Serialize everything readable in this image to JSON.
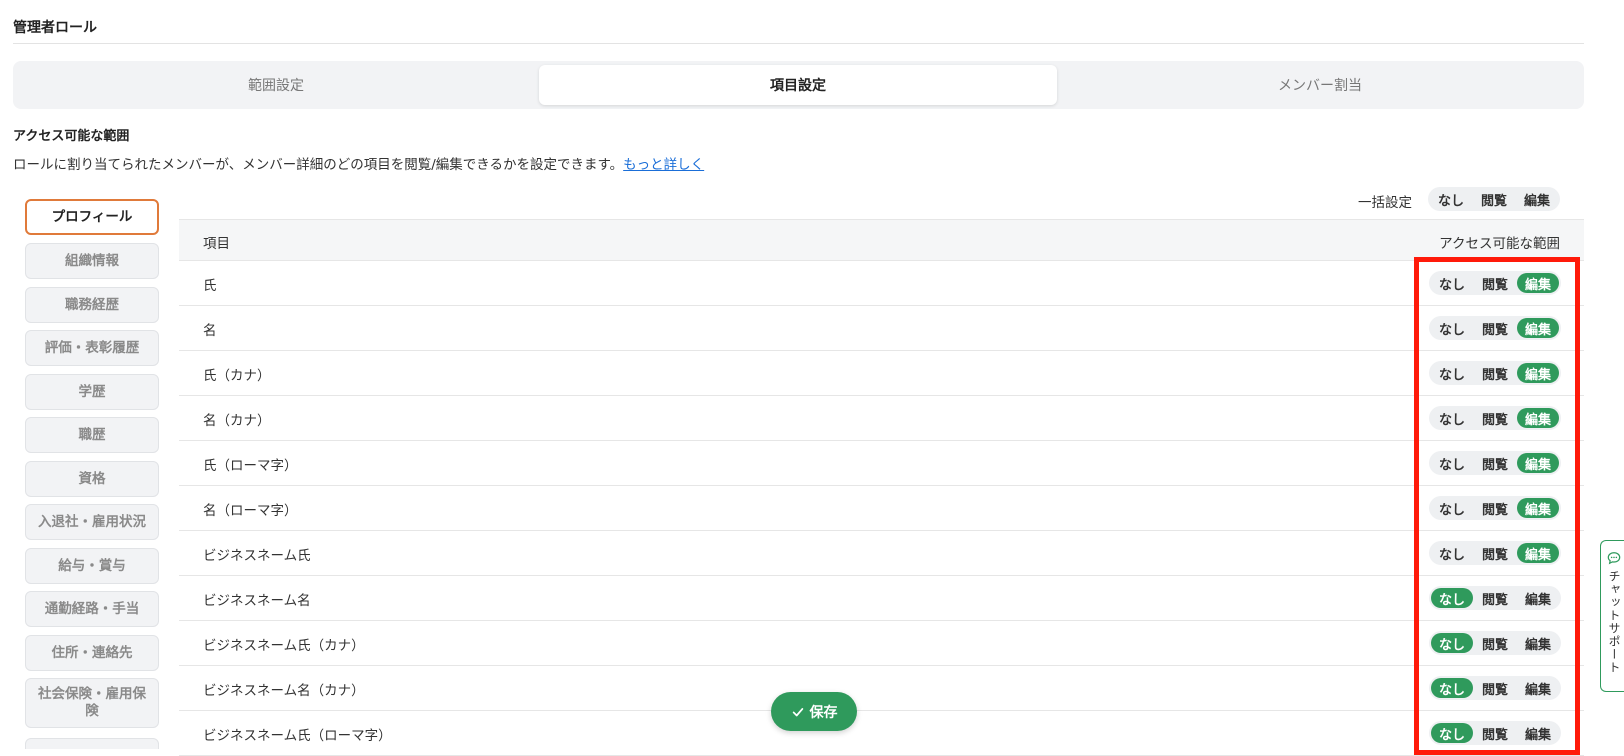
{
  "page": {
    "title": "管理者ロール"
  },
  "tabs": [
    {
      "label": "範囲設定"
    },
    {
      "label": "項目設定"
    },
    {
      "label": "メンバー割当"
    }
  ],
  "section": {
    "heading": "アクセス可能な範囲",
    "description": "ロールに割り当てられたメンバーが、メンバー詳細のどの項目を閲覧/編集できるかを設定できます。",
    "link": "もっと詳しく"
  },
  "sidebar": {
    "items": [
      {
        "label": "プロフィール"
      },
      {
        "label": "組織情報"
      },
      {
        "label": "職務経歴"
      },
      {
        "label": "評価・表彰履歴"
      },
      {
        "label": "学歴"
      },
      {
        "label": "職歴"
      },
      {
        "label": "資格"
      },
      {
        "label": "入退社・雇用状況"
      },
      {
        "label": "給与・賞与"
      },
      {
        "label": "通勤経路・手当"
      },
      {
        "label": "住所・連絡先"
      },
      {
        "label": "社会保険・雇用保険"
      }
    ]
  },
  "bulk": {
    "label": "一括設定",
    "options": [
      "なし",
      "閲覧",
      "編集"
    ]
  },
  "table": {
    "headers": {
      "item": "項目",
      "scope": "アクセス可能な範囲"
    },
    "options": [
      "なし",
      "閲覧",
      "編集"
    ],
    "rows": [
      {
        "label": "氏",
        "selected": "編集"
      },
      {
        "label": "名",
        "selected": "編集"
      },
      {
        "label": "氏（カナ）",
        "selected": "編集"
      },
      {
        "label": "名（カナ）",
        "selected": "編集"
      },
      {
        "label": "氏（ローマ字）",
        "selected": "編集"
      },
      {
        "label": "名（ローマ字）",
        "selected": "編集"
      },
      {
        "label": "ビジネスネーム氏",
        "selected": "編集"
      },
      {
        "label": "ビジネスネーム名",
        "selected": "なし"
      },
      {
        "label": "ビジネスネーム氏（カナ）",
        "selected": "なし"
      },
      {
        "label": "ビジネスネーム名（カナ）",
        "selected": "なし"
      },
      {
        "label": "ビジネスネーム氏（ローマ字）",
        "selected": "なし"
      }
    ]
  },
  "save": {
    "label": "保存"
  },
  "chat": {
    "label": "チャットサポート"
  },
  "colors": {
    "accent": "#2f9a5c",
    "highlight": "#ff1a0a",
    "active_border": "#e07a3a"
  }
}
